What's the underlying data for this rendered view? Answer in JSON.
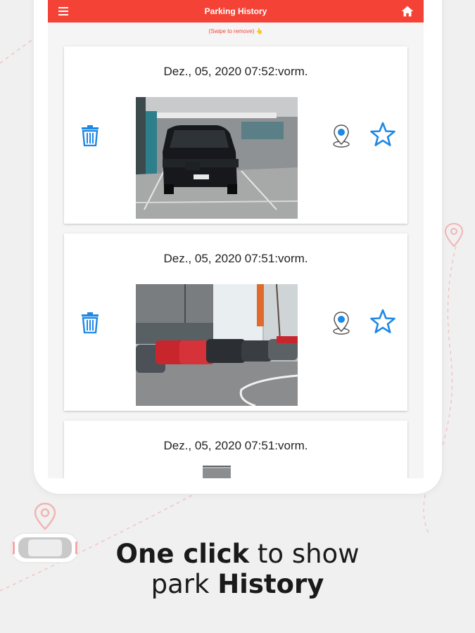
{
  "app_bar": {
    "title": "Parking History",
    "menu_icon": "hamburger-menu-icon",
    "home_icon": "home-icon",
    "color": "#f44336"
  },
  "hint": "(Swipe to remove) 👆",
  "history": [
    {
      "date": "Dez., 05, 2020 07:52:vorm.",
      "photo": "black-suv-in-parking-garage"
    },
    {
      "date": "Dez., 05, 2020 07:51:vorm.",
      "photo": "red-cars-outdoor-parking-lot"
    },
    {
      "date": "Dez., 05, 2020 07:51:vorm.",
      "photo": "parking-photo"
    }
  ],
  "card_icons": {
    "delete": "trash-icon",
    "location": "map-pin-icon",
    "favorite": "star-outline-icon",
    "icon_color": "#1e88e5"
  },
  "caption": {
    "line1_bold": "One click",
    "line1_rest": " to show",
    "line2_rest": "park ",
    "line2_bold": "History"
  }
}
